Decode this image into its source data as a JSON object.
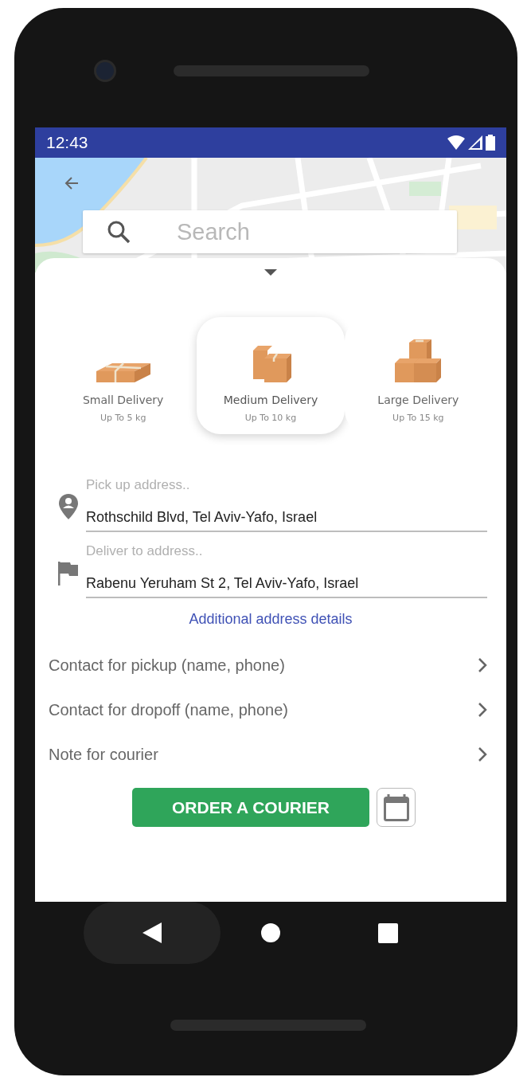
{
  "status_bar": {
    "time": "12:43"
  },
  "search": {
    "placeholder": "Search"
  },
  "delivery_options": [
    {
      "kind": "small",
      "title": "Small Delivery",
      "subtitle": "Up To 5 kg",
      "selected": false
    },
    {
      "kind": "medium",
      "title": "Medium Delivery",
      "subtitle": "Up To 10 kg",
      "selected": true
    },
    {
      "kind": "large",
      "title": "Large Delivery",
      "subtitle": "Up To 15 kg",
      "selected": false
    }
  ],
  "addresses": [
    {
      "kind": "pickup",
      "label": "Pick up address..",
      "value": "Rothschild Blvd, Tel Aviv-Yafo, Israel"
    },
    {
      "kind": "dropoff",
      "label": "Deliver to address..",
      "value": "Rabenu Yeruham St 2, Tel Aviv-Yafo, Israel"
    }
  ],
  "additional_link": "Additional address details",
  "contact_rows": [
    {
      "label": "Contact for pickup (name, phone)"
    },
    {
      "label": "Contact for dropoff (name, phone)"
    },
    {
      "label": "Note for courier"
    }
  ],
  "order_button": {
    "label": "ORDER A COURIER"
  }
}
